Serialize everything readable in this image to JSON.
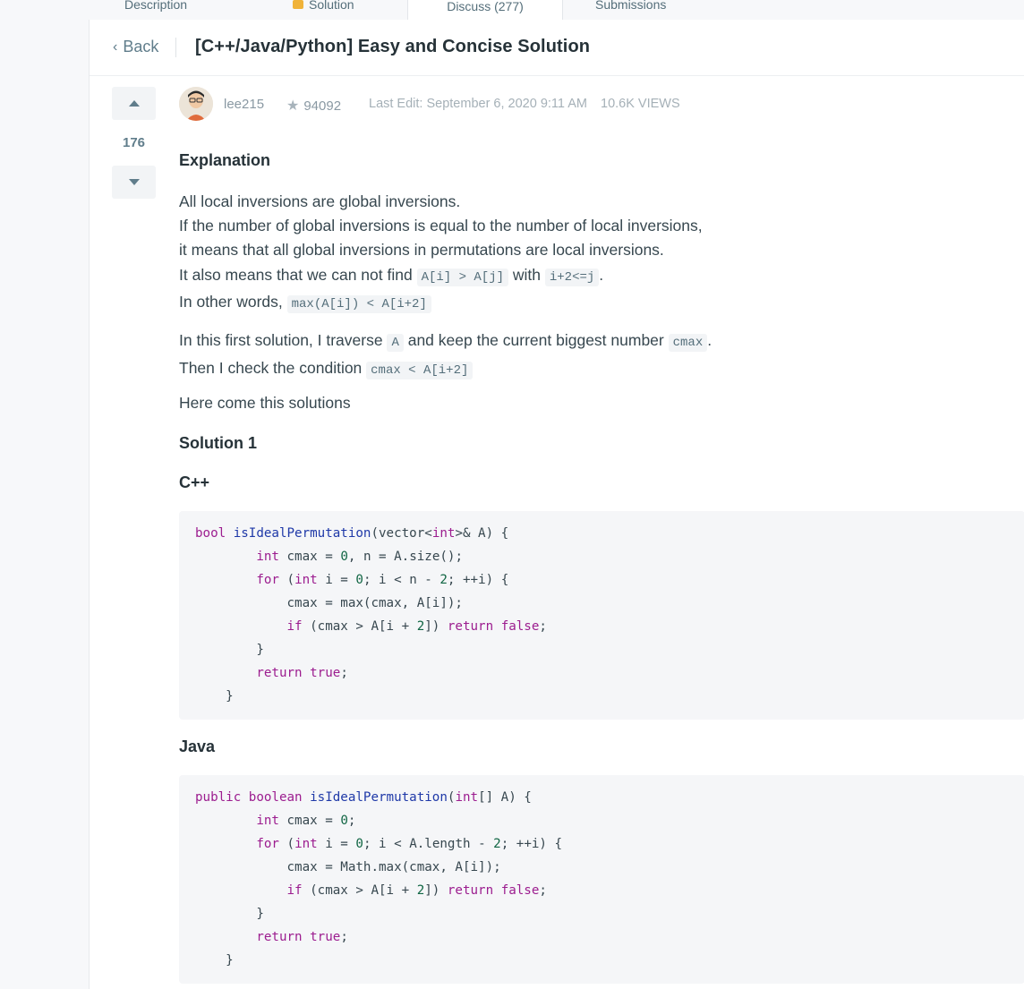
{
  "tabs": [
    "Description",
    "Solution",
    "Discuss (277)",
    "Submissions"
  ],
  "header": {
    "back_label": "Back",
    "title": "[C++/Java/Python] Easy and Concise Solution"
  },
  "vote": {
    "count": "176"
  },
  "meta": {
    "author": "lee215",
    "reputation": "94092",
    "last_edit": "Last Edit: September 6, 2020 9:11 AM",
    "views": "10.6K VIEWS"
  },
  "post": {
    "explanation_heading": "Explanation",
    "lines": {
      "l1": "All local inversions are global inversions.",
      "l2": "If the number of global inversions is equal to the number of local inversions,",
      "l3": "it means that all global inversions in permutations are local inversions.",
      "l4a": "It also means that we can not find ",
      "l4code1": "A[i] > A[j]",
      "l4b": " with ",
      "l4code2": "i+2<=j",
      "l4c": ".",
      "l5a": "In other words, ",
      "l5code": "max(A[i]) < A[i+2]",
      "l6a": "In this first solution, I traverse ",
      "l6code1": "A",
      "l6b": " and keep the current biggest number ",
      "l6code2": "cmax",
      "l6c": ".",
      "l7a": "Then I check the condition ",
      "l7code": "cmax < A[i+2]",
      "l8": "Here come this solutions"
    },
    "solution1_heading": "Solution 1",
    "cpp_heading": "C++",
    "java_heading": "Java"
  },
  "code_cpp": [
    "bool isIdealPermutation(vector<int>& A) {",
    "        int cmax = 0, n = A.size();",
    "        for (int i = 0; i < n - 2; ++i) {",
    "            cmax = max(cmax, A[i]);",
    "            if (cmax > A[i + 2]) return false;",
    "        }",
    "        return true;",
    "    }"
  ],
  "code_java": [
    "public boolean isIdealPermutation(int[] A) {",
    "        int cmax = 0;",
    "        for (int i = 0; i < A.length - 2; ++i) {",
    "            cmax = Math.max(cmax, A[i]);",
    "            if (cmax > A[i + 2]) return false;",
    "        }",
    "        return true;",
    "    }"
  ],
  "colors": {
    "keyword": "#9c1d8f",
    "function": "#1f39a8",
    "number": "#116644"
  }
}
